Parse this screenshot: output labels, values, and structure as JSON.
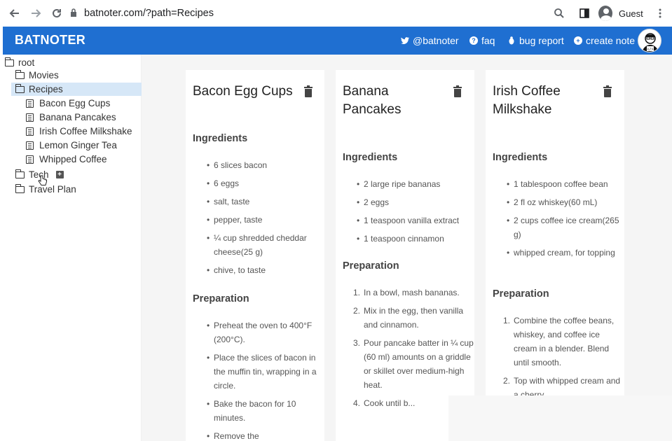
{
  "browser": {
    "url": "batnoter.com/?path=Recipes",
    "guest_label": "Guest"
  },
  "header": {
    "brand": "BATNOTER",
    "links": [
      {
        "label": "@batnoter",
        "icon": "twitter-icon"
      },
      {
        "label": "faq",
        "icon": "help-circle-icon"
      },
      {
        "label": "bug report",
        "icon": "bug-icon"
      },
      {
        "label": "create note",
        "icon": "plus-circle-icon"
      }
    ]
  },
  "sidebar": {
    "root": "root",
    "folders": [
      "Movies",
      "Recipes",
      "Tech",
      "Travel Plan"
    ],
    "recipes": [
      "Bacon Egg Cups",
      "Banana Pancakes",
      "Irish Coffee Milkshake",
      "Lemon Ginger Tea",
      "Whipped Coffee"
    ]
  },
  "cards": [
    {
      "title": "Bacon Egg Cups",
      "ingredients_heading": "Ingredients",
      "ingredients": [
        "6 slices bacon",
        "6 eggs",
        "salt, taste",
        "pepper, taste",
        "¼ cup shredded cheddar cheese(25 g)",
        "chive, to taste"
      ],
      "preparation_heading": "Preparation",
      "preparation": [
        "Preheat the oven to 400°F (200°C).",
        "Place the slices of bacon in the muffin tin, wrapping in a circle.",
        "Bake the bacon for 10 minutes.",
        "Remove the"
      ]
    },
    {
      "title": "Banana Pancakes",
      "ingredients_heading": "Ingredients",
      "ingredients": [
        "2 large ripe bananas",
        "2 eggs",
        "1 teaspoon vanilla extract",
        "1 teaspoon cinnamon"
      ],
      "preparation_heading": "Preparation",
      "preparation": [
        "In a bowl, mash bananas.",
        "Mix in the egg, then vanilla and cinnamon.",
        "Pour pancake batter in ¼ cup (60 ml) amounts on a griddle or skillet over medium-high heat.",
        "Cook until b..."
      ]
    },
    {
      "title": "Irish Coffee Milkshake",
      "ingredients_heading": "Ingredients",
      "ingredients": [
        "1 tablespoon coffee bean",
        "2 fl oz whiskey(60 mL)",
        "2 cups coffee ice cream(265 g)",
        "whipped cream, for topping"
      ],
      "preparation_heading": "Preparation",
      "preparation": [
        "Combine the coffee beans, whiskey, and coffee ice cream in a blender. Blend until smooth.",
        "Top with whipped cream and a cherry"
      ]
    }
  ],
  "colors": {
    "header_bg": "#1f6fd1",
    "selected_bg": "#d6e7f7",
    "main_bg": "#f5f5f5"
  }
}
